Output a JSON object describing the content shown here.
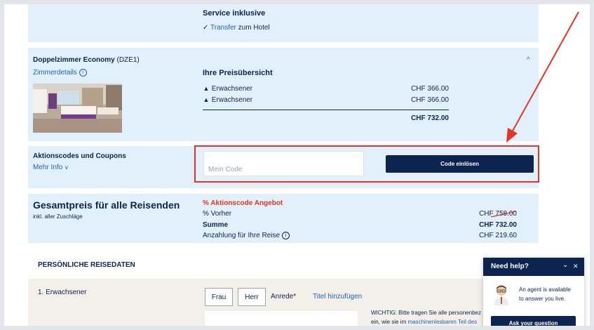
{
  "service": {
    "heading": "Service inklusive",
    "check": "✓",
    "transfer_link": "Transfer",
    "transfer_suffix": "zum Hotel"
  },
  "room": {
    "name": "Doppelzimmer Economy",
    "code": "(DZE1)",
    "details_link": "Zimmerdetails",
    "chevron": "^",
    "price_heading": "Ihre Preisübersicht",
    "rows": [
      {
        "label": "Erwachsener",
        "price": "CHF 366.00"
      },
      {
        "label": "Erwachsener",
        "price": "CHF 366.00"
      }
    ],
    "total": "CHF 732.00"
  },
  "coupon": {
    "heading": "Aktionscodes und Coupons",
    "more_info": "Mehr Info",
    "input_placeholder": "Mein Code",
    "button_label": "Code einlösen"
  },
  "total": {
    "heading": "Gesamtpreis für alle Reisenden",
    "subheading": "inkl. aller Zuschläge",
    "promo_label": "% Aktionscode Angebot",
    "rows": [
      {
        "label": "% Vorher",
        "value": "CHF 758.00"
      },
      {
        "label": "Summe",
        "value": "CHF 732.00"
      },
      {
        "label": "Anzahlung für Ihre Reise",
        "value": "CHF 219.60"
      }
    ]
  },
  "personal": {
    "heading": "PERSÖNLICHE REISEDATEN",
    "traveler": "1. Erwachsener",
    "frau": "Frau",
    "herr": "Herr",
    "anrede": "Anrede*",
    "title_link": "Titel hinzufügen",
    "notice_line1": "WICHTIG: Bitte tragen Sie alle personenbez",
    "notice_line2_a": "ein, wie sie im",
    "notice_line2_link": "maschinenlesbaren Teil des"
  },
  "chat": {
    "title": "Need help?",
    "minimize": "⌄",
    "close": "✕",
    "message_line1": "An agent is available",
    "message_line2": "to answer you live.",
    "button_label": "Ask your question"
  },
  "colors": {
    "navy": "#0d2350",
    "panel": "#e1f0fb",
    "link": "#1f62b8",
    "annotation_red": "#e63422",
    "beige": "#f3efe9"
  }
}
